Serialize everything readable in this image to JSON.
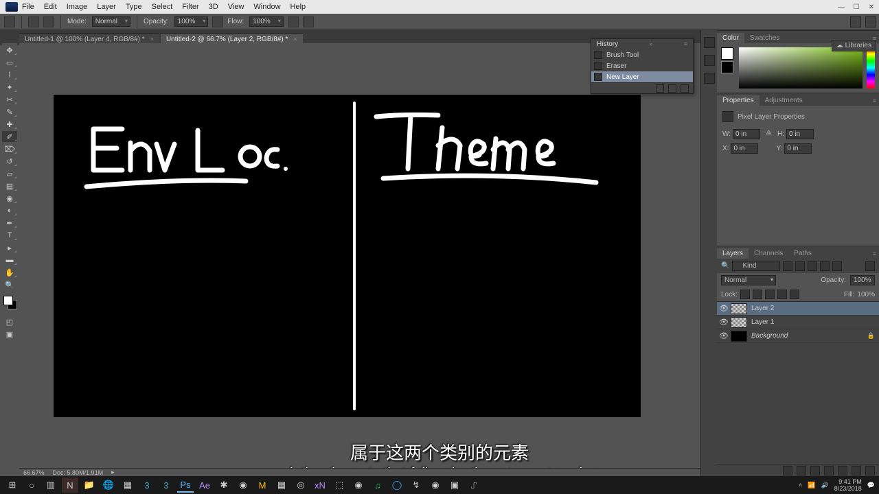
{
  "menu": {
    "items": [
      "File",
      "Edit",
      "Image",
      "Layer",
      "Type",
      "Select",
      "Filter",
      "3D",
      "View",
      "Window",
      "Help"
    ]
  },
  "options": {
    "mode_label": "Mode:",
    "mode_value": "Normal",
    "opacity_label": "Opacity:",
    "opacity_value": "100%",
    "flow_label": "Flow:",
    "flow_value": "100%"
  },
  "tabs": [
    {
      "label": "Untitled-1 @ 100% (Layer 4, RGB/8#) *",
      "active": false
    },
    {
      "label": "Untitled-2 @ 66.7% (Layer 2, RGB/8#) *",
      "active": true
    }
  ],
  "status": {
    "zoom": "66.67%",
    "doc": "Doc: 5.80M/1.91M"
  },
  "libraries_label": "Libraries",
  "color_panel": {
    "tab_color": "Color",
    "tab_swatches": "Swatches"
  },
  "history_panel": {
    "title": "History",
    "items": [
      "Brush Tool",
      "Eraser",
      "New Layer"
    ],
    "selected": 2
  },
  "properties_panel": {
    "tab_props": "Properties",
    "tab_adj": "Adjustments",
    "header": "Pixel Layer Properties",
    "w_label": "W:",
    "w_value": "0 in",
    "h_label": "H:",
    "h_value": "0 in",
    "x_label": "X:",
    "x_value": "0 in",
    "y_label": "Y:",
    "y_value": "0 in"
  },
  "layers_panel": {
    "tab_layers": "Layers",
    "tab_channels": "Channels",
    "tab_paths": "Paths",
    "filter_label": "Kind",
    "blend_mode": "Normal",
    "opacity_label": "Opacity:",
    "opacity_value": "100%",
    "lock_label": "Lock:",
    "fill_label": "Fill:",
    "fill_value": "100%",
    "layers": [
      {
        "name": "Layer 2",
        "selected": true,
        "thumb": "checker",
        "italic": false,
        "locked": false
      },
      {
        "name": "Layer 1",
        "selected": false,
        "thumb": "checker",
        "italic": false,
        "locked": false
      },
      {
        "name": "Background",
        "selected": false,
        "thumb": "black",
        "italic": true,
        "locked": true
      }
    ]
  },
  "subtitles": {
    "cn": "属于这两个类别的元素",
    "en": "uh the elements that fall under these two categories"
  },
  "taskbar": {
    "time": "9:41 PM",
    "date": "8/23/2018"
  }
}
